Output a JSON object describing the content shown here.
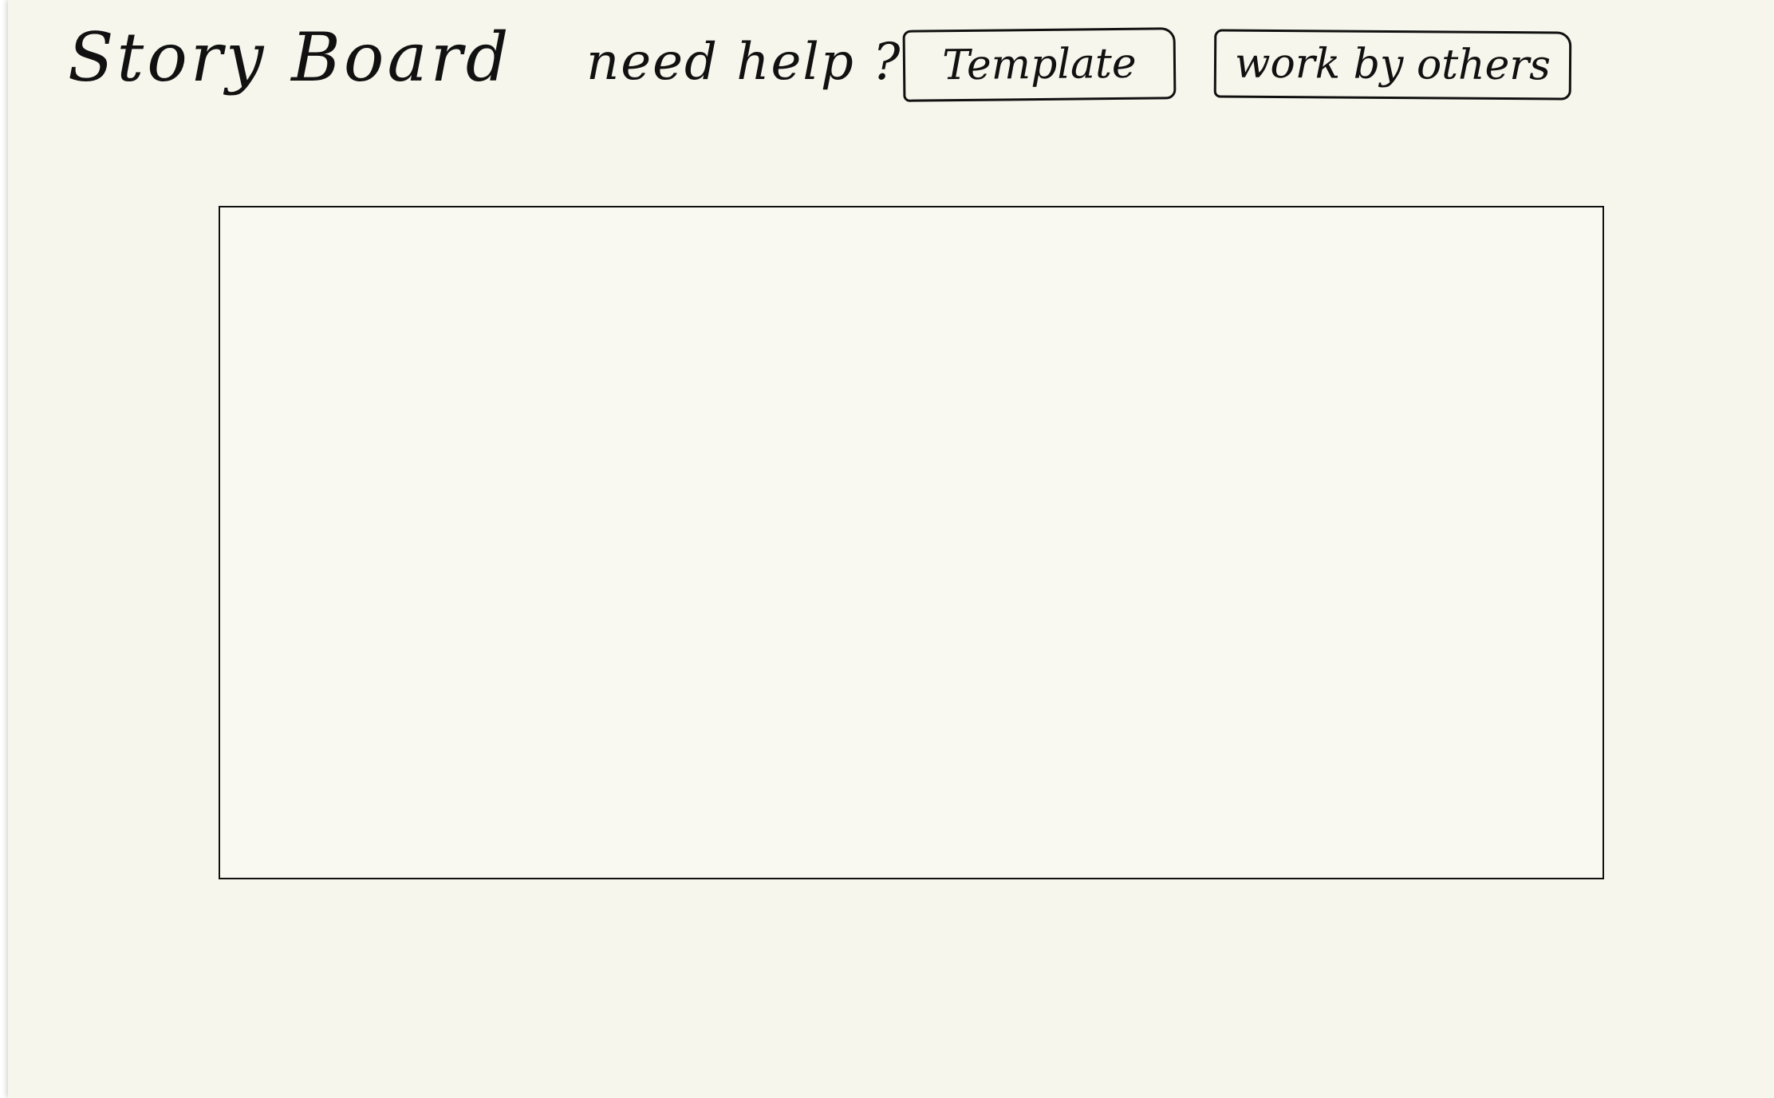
{
  "header": {
    "title": "Story Board",
    "help_prompt": "need help ?",
    "template_button_label": "Template",
    "others_button_label": "work by others"
  },
  "colors": {
    "paper": "#f6f6ec",
    "ink": "#111111"
  }
}
